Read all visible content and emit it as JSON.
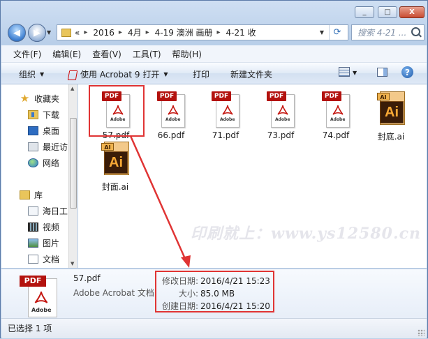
{
  "window": {
    "controls": [
      "_",
      "□",
      "X"
    ]
  },
  "address": {
    "overflow": "«",
    "crumbs": [
      "2016",
      "4月",
      "4-19 澳洲 画册",
      "4-21 收"
    ],
    "search_placeholder": "搜索 4-21 ..."
  },
  "menu": [
    "文件(F)",
    "编辑(E)",
    "查看(V)",
    "工具(T)",
    "帮助(H)"
  ],
  "toolbar": {
    "organize": "组织",
    "open_with": "使用 Acrobat 9 打开",
    "print": "打印",
    "new_folder": "新建文件夹"
  },
  "nav": {
    "favorites": "收藏夹",
    "downloads": "下载",
    "desktop": "桌面",
    "recent": "最近访",
    "network": "网络",
    "library": "库",
    "haiyi": "海日工",
    "video": "视频",
    "pictures": "图片",
    "documents": "文档"
  },
  "files": [
    {
      "name": "57.pdf",
      "type": "pdf"
    },
    {
      "name": "66.pdf",
      "type": "pdf"
    },
    {
      "name": "71.pdf",
      "type": "pdf"
    },
    {
      "name": "73.pdf",
      "type": "pdf"
    },
    {
      "name": "74.pdf",
      "type": "pdf"
    },
    {
      "name": "封底.ai",
      "type": "ai"
    },
    {
      "name": "封面.ai",
      "type": "ai"
    }
  ],
  "icon_text": {
    "pdf": "PDF",
    "ai": "Ai",
    "ai_tag": "AI",
    "adobe": "Adobe"
  },
  "watermark": "印刷就上：www.ys12580.cn",
  "details": {
    "name": "57.pdf",
    "type": "Adobe Acrobat 文档",
    "modified_label": "修改日期:",
    "modified": "2016/4/21 15:23",
    "size_label": "大小:",
    "size": "85.0 MB",
    "created_label": "创建日期:",
    "created": "2016/4/21 15:20"
  },
  "status": "已选择 1 项",
  "colors": {
    "highlight": "#e03434",
    "pdf_red": "#b3120e",
    "ai_orange": "#f7a835"
  }
}
